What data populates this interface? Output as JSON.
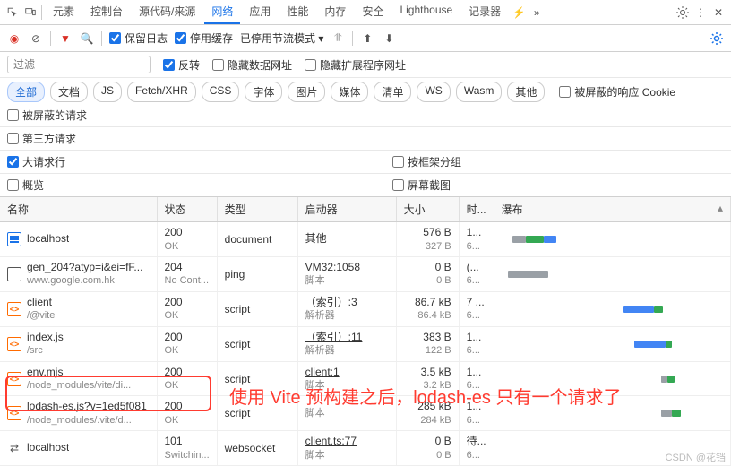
{
  "topbar": {
    "tabs": [
      "元素",
      "控制台",
      "源代码/来源",
      "网络",
      "应用",
      "性能",
      "内存",
      "安全",
      "Lighthouse",
      "记录器"
    ],
    "activeIndex": 3,
    "beta": "⚡"
  },
  "toolbar": {
    "preserveLog": "保留日志",
    "disableCache": "停用缓存",
    "throttle": "已停用节流模式"
  },
  "filter": {
    "placeholder": "过滤",
    "invert": "反转",
    "hideData": "隐藏数据网址",
    "hideExt": "隐藏扩展程序网址"
  },
  "types": [
    "全部",
    "文档",
    "JS",
    "Fetch/XHR",
    "CSS",
    "字体",
    "图片",
    "媒体",
    "清单",
    "WS",
    "Wasm",
    "其他"
  ],
  "typeExtra": {
    "blockedCookie": "被屏蔽的响应 Cookie",
    "blockedReq": "被屏蔽的请求",
    "thirdParty": "第三方请求"
  },
  "subopts": {
    "bigReq": "大请求行",
    "groupFrame": "按框架分组",
    "overview": "概览",
    "screenshot": "屏幕截图"
  },
  "cols": {
    "name": "名称",
    "status": "状态",
    "type": "类型",
    "initiator": "启动器",
    "size": "大小",
    "time": "时...",
    "waterfall": "瀑布"
  },
  "rows": [
    {
      "icon": "doc",
      "name": "localhost",
      "path": "",
      "status": "200",
      "statusText": "OK",
      "type": "document",
      "init": "其他",
      "initSub": "",
      "size": "576 B",
      "sizeSub": "327 B",
      "time": "1...",
      "wf": [
        {
          "l": 5,
          "w": 6,
          "c": "#9aa0a6"
        },
        {
          "l": 11,
          "w": 8,
          "c": "#34a853"
        },
        {
          "l": 19,
          "w": 6,
          "c": "#4285f4"
        }
      ]
    },
    {
      "icon": "box",
      "name": "gen_204?atyp=i&ei=fF...",
      "path": "www.google.com.hk",
      "status": "204",
      "statusText": "No Cont...",
      "type": "ping",
      "init": "VM32:1058",
      "initSub": "脚本",
      "initLink": true,
      "size": "0 B",
      "sizeSub": "0 B",
      "time": "(...",
      "wf": [
        {
          "l": 3,
          "w": 18,
          "c": "#9aa0a6"
        }
      ]
    },
    {
      "icon": "js",
      "name": "client",
      "path": "/@vite",
      "status": "200",
      "statusText": "OK",
      "type": "script",
      "init": "（索引）:3",
      "initSub": "解析器",
      "initLink": true,
      "size": "86.7 kB",
      "sizeSub": "86.4 kB",
      "time": "7 ...",
      "wf": [
        {
          "l": 55,
          "w": 14,
          "c": "#4285f4"
        },
        {
          "l": 69,
          "w": 4,
          "c": "#34a853"
        }
      ]
    },
    {
      "icon": "js",
      "name": "index.js",
      "path": "/src",
      "status": "200",
      "statusText": "OK",
      "type": "script",
      "init": "（索引）:11",
      "initSub": "解析器",
      "initLink": true,
      "size": "383 B",
      "sizeSub": "122 B",
      "time": "1...",
      "wf": [
        {
          "l": 60,
          "w": 14,
          "c": "#4285f4"
        },
        {
          "l": 74,
          "w": 3,
          "c": "#34a853"
        }
      ]
    },
    {
      "icon": "js",
      "name": "env.mjs",
      "path": "/node_modules/vite/di...",
      "status": "200",
      "statusText": "OK",
      "type": "script",
      "init": "client:1",
      "initSub": "脚本",
      "initLink": true,
      "size": "3.5 kB",
      "sizeSub": "3.2 kB",
      "time": "1...",
      "wf": [
        {
          "l": 72,
          "w": 3,
          "c": "#9aa0a6"
        },
        {
          "l": 75,
          "w": 3,
          "c": "#34a853"
        }
      ]
    },
    {
      "icon": "js",
      "name": "lodash-es.js?v=1ed5f081",
      "path": "/node_modules/.vite/d...",
      "status": "200",
      "statusText": "OK",
      "type": "script",
      "init": "",
      "initSub": "脚本",
      "size": "285 kB",
      "sizeSub": "284 kB",
      "time": "1...",
      "wf": [
        {
          "l": 72,
          "w": 5,
          "c": "#9aa0a6"
        },
        {
          "l": 77,
          "w": 4,
          "c": "#34a853"
        }
      ],
      "highlight": true
    },
    {
      "icon": "ws",
      "name": "localhost",
      "path": "",
      "status": "101",
      "statusText": "Switchin...",
      "type": "websocket",
      "init": "client.ts:77",
      "initSub": "脚本",
      "initLink": true,
      "size": "0 B",
      "sizeSub": "0 B",
      "time": "待...",
      "wf": []
    }
  ],
  "annotation": "使用 Vite 预构建之后，lodash-es 只有一个请求了",
  "watermark": "CSDN @花铛"
}
